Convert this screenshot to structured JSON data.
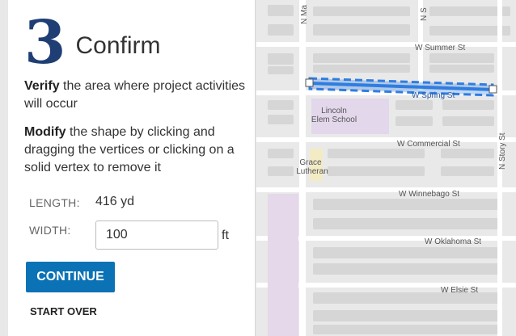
{
  "step": {
    "number": "3",
    "title": "Confirm"
  },
  "instructions": {
    "verify_bold": "Verify",
    "verify_rest": " the area where project activities will occur",
    "modify_bold": "Modify",
    "modify_rest": " the shape by clicking and dragging the vertices or clicking on a solid vertex to remove it"
  },
  "length": {
    "label": "LENGTH:",
    "value": "416 yd"
  },
  "width": {
    "label": "WIDTH:",
    "value": "100",
    "unit": "ft"
  },
  "buttons": {
    "continue": "CONTINUE",
    "start_over": "START OVER"
  },
  "map": {
    "streets": {
      "summer": "W Summer St",
      "spring": "W Spring St",
      "commercial": "W Commercial St",
      "winnebago": "W Winnebago St",
      "oklahoma": "W Oklahoma St",
      "elsie": "W Elsie St",
      "story": "N Story St",
      "ma": "N Ma",
      "n_s": "N S"
    },
    "places": {
      "lincoln_1": "Lincoln",
      "lincoln_2": "Elem School",
      "grace_1": "Grace",
      "grace_2": "Lutheran"
    },
    "colors": {
      "selection": "#2f7de0",
      "school": "#e3d7ec",
      "church": "#f2ebc4",
      "park": "#e4d8ea"
    }
  }
}
